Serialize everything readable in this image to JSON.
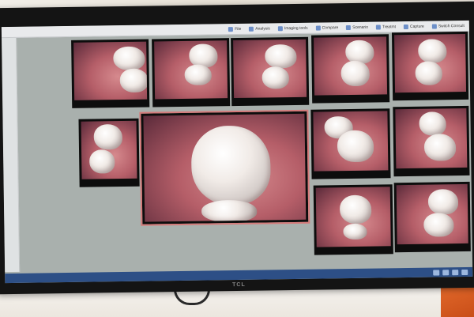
{
  "scene": {
    "monitor_brand": "TCL"
  },
  "toolbar": {
    "items": [
      {
        "icon": "file-icon",
        "label": "File"
      },
      {
        "icon": "analysis-icon",
        "label": "Analysis"
      },
      {
        "icon": "imaging-icon",
        "label": "Imaging tools"
      },
      {
        "icon": "compare-icon",
        "label": "Compare"
      },
      {
        "icon": "scenario-icon",
        "label": "Scenario"
      },
      {
        "icon": "treat-icon",
        "label": "Treatmt"
      },
      {
        "icon": "capture-icon",
        "label": "Capture"
      },
      {
        "icon": "patient-icon",
        "label": "Switch Consult"
      }
    ]
  },
  "colors": {
    "screen_bg": "#a9b0ad",
    "caption_text": "#3ad06a",
    "selected_border": "#d47a7a",
    "taskbar": "#2d4f86"
  }
}
